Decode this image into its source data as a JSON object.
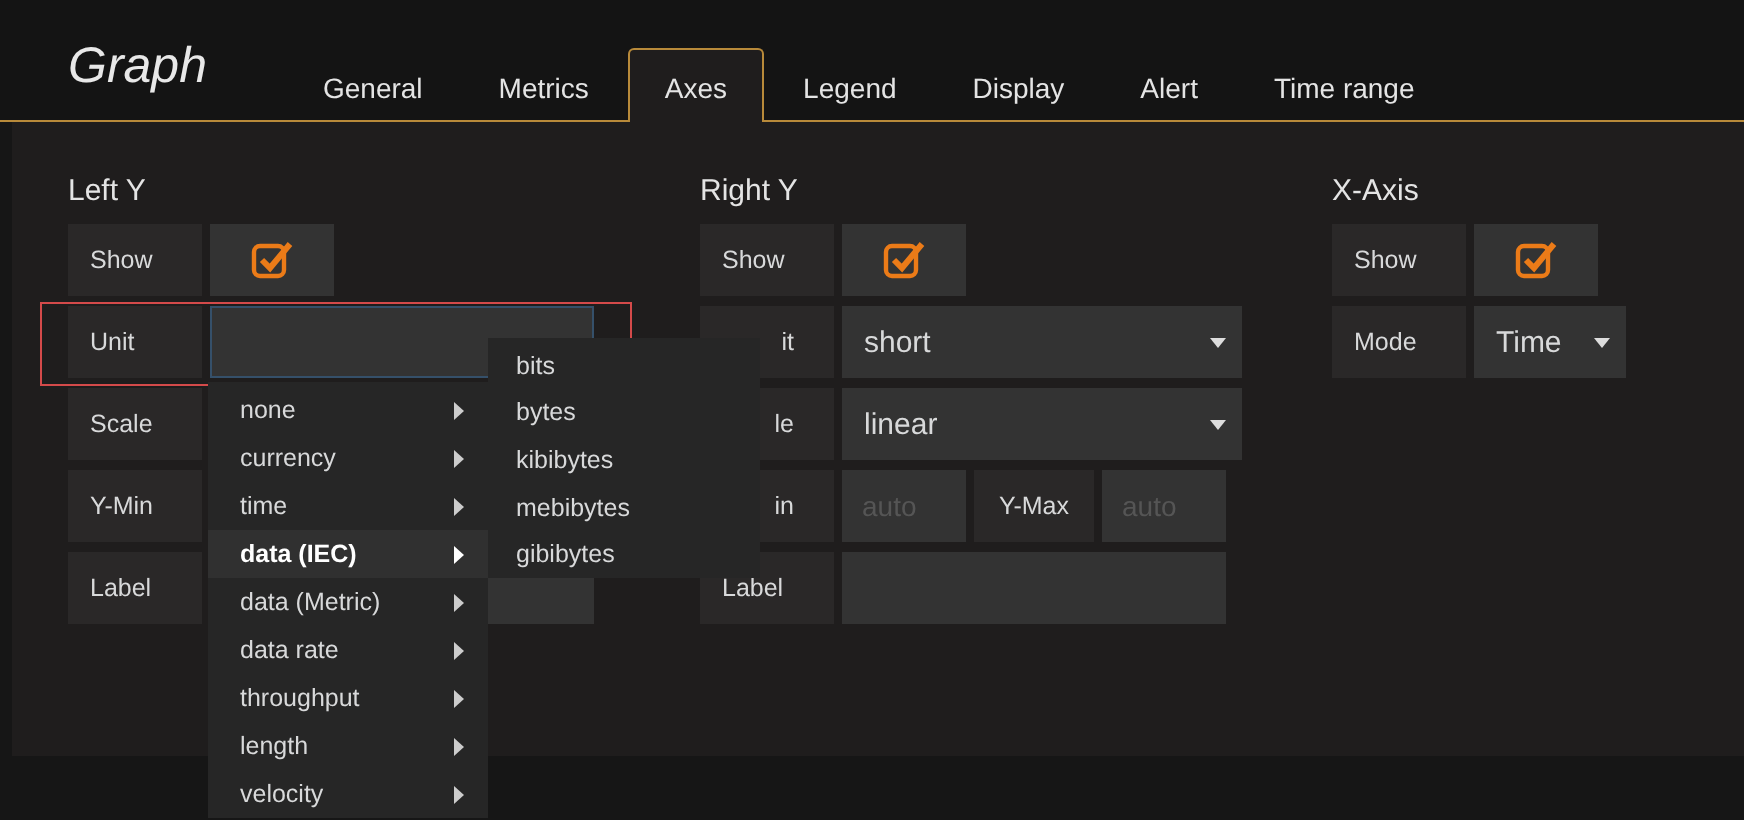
{
  "title": "Graph",
  "tabs": [
    {
      "label": "General",
      "selected": false
    },
    {
      "label": "Metrics",
      "selected": false
    },
    {
      "label": "Axes",
      "selected": true
    },
    {
      "label": "Legend",
      "selected": false
    },
    {
      "label": "Display",
      "selected": false
    },
    {
      "label": "Alert",
      "selected": false
    },
    {
      "label": "Time range",
      "selected": false
    }
  ],
  "sections": [
    {
      "title": "Left Y",
      "rows": [
        {
          "kind": "checkbox",
          "label": "Show",
          "checked": true
        },
        {
          "kind": "input",
          "label": "Unit",
          "focused": true,
          "highlighted": true
        },
        {
          "kind": "under-menu",
          "label": "Scale"
        },
        {
          "kind": "under-menu",
          "label": "Y-Min"
        },
        {
          "kind": "input",
          "label": "Label",
          "focused": false,
          "highlighted": false
        }
      ],
      "menu": {
        "items": [
          {
            "label": "none",
            "selected": false
          },
          {
            "label": "currency",
            "selected": false
          },
          {
            "label": "time",
            "selected": false
          },
          {
            "label": "data (IEC)",
            "selected": true
          },
          {
            "label": "data (Metric)",
            "selected": false
          },
          {
            "label": "data rate",
            "selected": false
          },
          {
            "label": "throughput",
            "selected": false
          },
          {
            "label": "length",
            "selected": false
          },
          {
            "label": "velocity",
            "selected": false
          }
        ],
        "submenu": [
          "bits",
          "bytes",
          "kibibytes",
          "mebibytes",
          "gibibytes"
        ]
      }
    },
    {
      "title": "Right Y",
      "rows": [
        {
          "kind": "checkbox",
          "label": "Show",
          "checked": true
        },
        {
          "kind": "select",
          "label": "it",
          "covered": true,
          "value": "short"
        },
        {
          "kind": "select",
          "label": "le",
          "covered": true,
          "value": "linear"
        },
        {
          "kind": "minmax",
          "label": "in",
          "covered": true,
          "placeholder": "auto",
          "label2": "Y-Max",
          "placeholder2": "auto"
        },
        {
          "kind": "input",
          "label": "Label",
          "focused": false,
          "highlighted": false
        }
      ]
    },
    {
      "title": "X-Axis",
      "rows": [
        {
          "kind": "checkbox",
          "label": "Show",
          "checked": true
        },
        {
          "kind": "smallselect",
          "label": "Mode",
          "value": "Time"
        }
      ]
    }
  ]
}
